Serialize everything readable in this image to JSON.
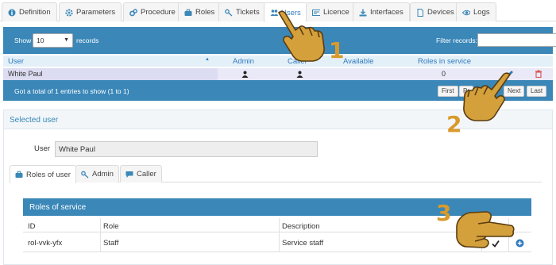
{
  "tabs": [
    {
      "label": "Definition",
      "icon": "info-icon"
    },
    {
      "label": "Parameters",
      "icon": "gear-icon"
    },
    {
      "label": "Procedure",
      "icon": "gears-icon"
    },
    {
      "label": "Roles",
      "icon": "briefcase-icon"
    },
    {
      "label": "Tickets",
      "icon": "key-icon"
    },
    {
      "label": "Users",
      "icon": "users-icon",
      "active": true
    },
    {
      "label": "Licence",
      "icon": "licence-icon"
    },
    {
      "label": "Interfaces",
      "icon": "download-icon"
    },
    {
      "label": "Devices",
      "icon": "file-icon"
    },
    {
      "label": "Logs",
      "icon": "eye-icon"
    }
  ],
  "users_table": {
    "show_label": "Show",
    "page_size": "10",
    "records_label": "records",
    "filter_label": "Filter records:",
    "filter_value": "",
    "columns": [
      "User",
      "Admin",
      "Caller",
      "Available",
      "Roles in service"
    ],
    "rows": [
      {
        "user": "White Paul",
        "roles_in_service": "0"
      }
    ],
    "footer": "Got a total of 1 entries to show (1 to 1)",
    "pagination": [
      "First",
      "Pr",
      "Next",
      "Last"
    ]
  },
  "selected_user": {
    "title": "Selected user",
    "user_label": "User",
    "user_value": "White Paul",
    "tabs": [
      {
        "label": "Roles of user",
        "icon": "briefcase-icon"
      },
      {
        "label": "Admin",
        "icon": "key-icon"
      },
      {
        "label": "Caller",
        "icon": "chat-icon"
      }
    ]
  },
  "roles_of_service": {
    "title": "Roles of service",
    "columns": [
      "ID",
      "Role",
      "Description"
    ],
    "rows": [
      {
        "id": "rol-vvk-yfx",
        "role": "Staff",
        "description": "Service staff"
      }
    ]
  },
  "steps": [
    "1",
    "2",
    "3"
  ],
  "colors": {
    "accent": "#3a87b8",
    "link": "#2f7bbf",
    "delete": "#d9534f",
    "step": "#d99a2b"
  }
}
